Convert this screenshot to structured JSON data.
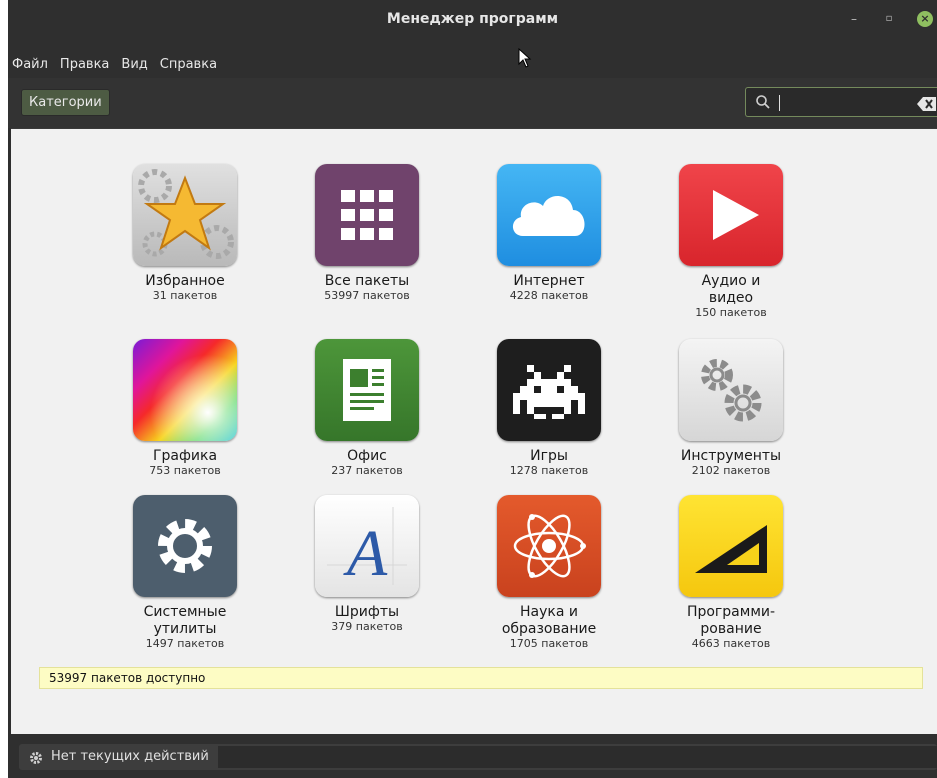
{
  "window": {
    "title": "Менеджер программ",
    "controls": {
      "minimize": "–",
      "maximize": "▫",
      "close": "×"
    }
  },
  "menu": [
    "Файл",
    "Правка",
    "Вид",
    "Справка"
  ],
  "toolbar": {
    "categories_label": "Категории",
    "search_value": ""
  },
  "categories": [
    {
      "name": "Избранное",
      "count": "31 пакетов",
      "icon": "star-icon"
    },
    {
      "name": "Все пакеты",
      "count": "53997 пакетов",
      "icon": "grid-icon"
    },
    {
      "name": "Интернет",
      "count": "4228 пакетов",
      "icon": "cloud-icon"
    },
    {
      "name": "Аудио и",
      "name2": "видео",
      "count": "150 пакетов",
      "icon": "play-icon"
    },
    {
      "name": "Графика",
      "count": "753 пакетов",
      "icon": "color-gradient-icon"
    },
    {
      "name": "Офис",
      "count": "237 пакетов",
      "icon": "document-icon"
    },
    {
      "name": "Игры",
      "count": "1278 пакетов",
      "icon": "space-invader-icon"
    },
    {
      "name": "Инструменты",
      "count": "2102 пакетов",
      "icon": "gears-icon"
    },
    {
      "name": "Системные",
      "name2": "утилиты",
      "count": "1497 пакетов",
      "icon": "gear-icon"
    },
    {
      "name": "Шрифты",
      "count": "379 пакетов",
      "icon": "font-icon"
    },
    {
      "name": "Наука и",
      "name2": "образование",
      "count": "1705 пакетов",
      "icon": "atom-icon"
    },
    {
      "name": "Программи-",
      "name2": "рование",
      "count": "4663 пакетов",
      "icon": "set-square-icon"
    }
  ],
  "status": {
    "available": "53997 пакетов доступно"
  },
  "bottom": {
    "activity": "Нет текущих действий"
  },
  "colors": {
    "accent": "#8fbf60",
    "window_bg": "#2f2f2f",
    "content_bg": "#f1f1f1",
    "status_bg": "#fdfcc4"
  }
}
